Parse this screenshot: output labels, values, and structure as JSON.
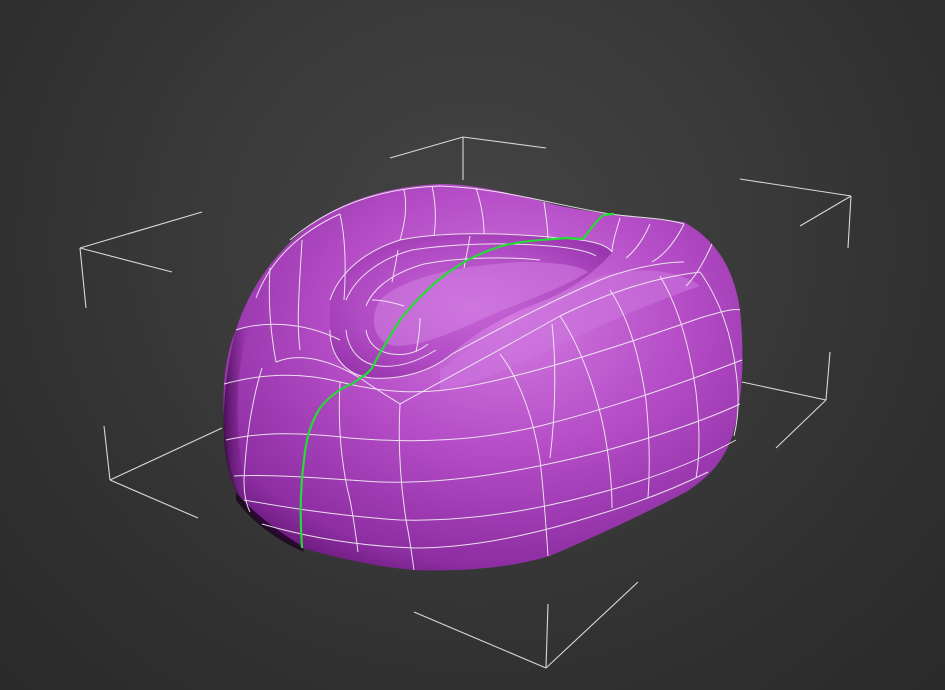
{
  "viewport": {
    "background": "#2b2b2b",
    "object_color": "#b24bc4",
    "wire_color": "#ffffff",
    "selected_edge_color": "#22dd33",
    "bbox_color": "#d8d8d8"
  }
}
